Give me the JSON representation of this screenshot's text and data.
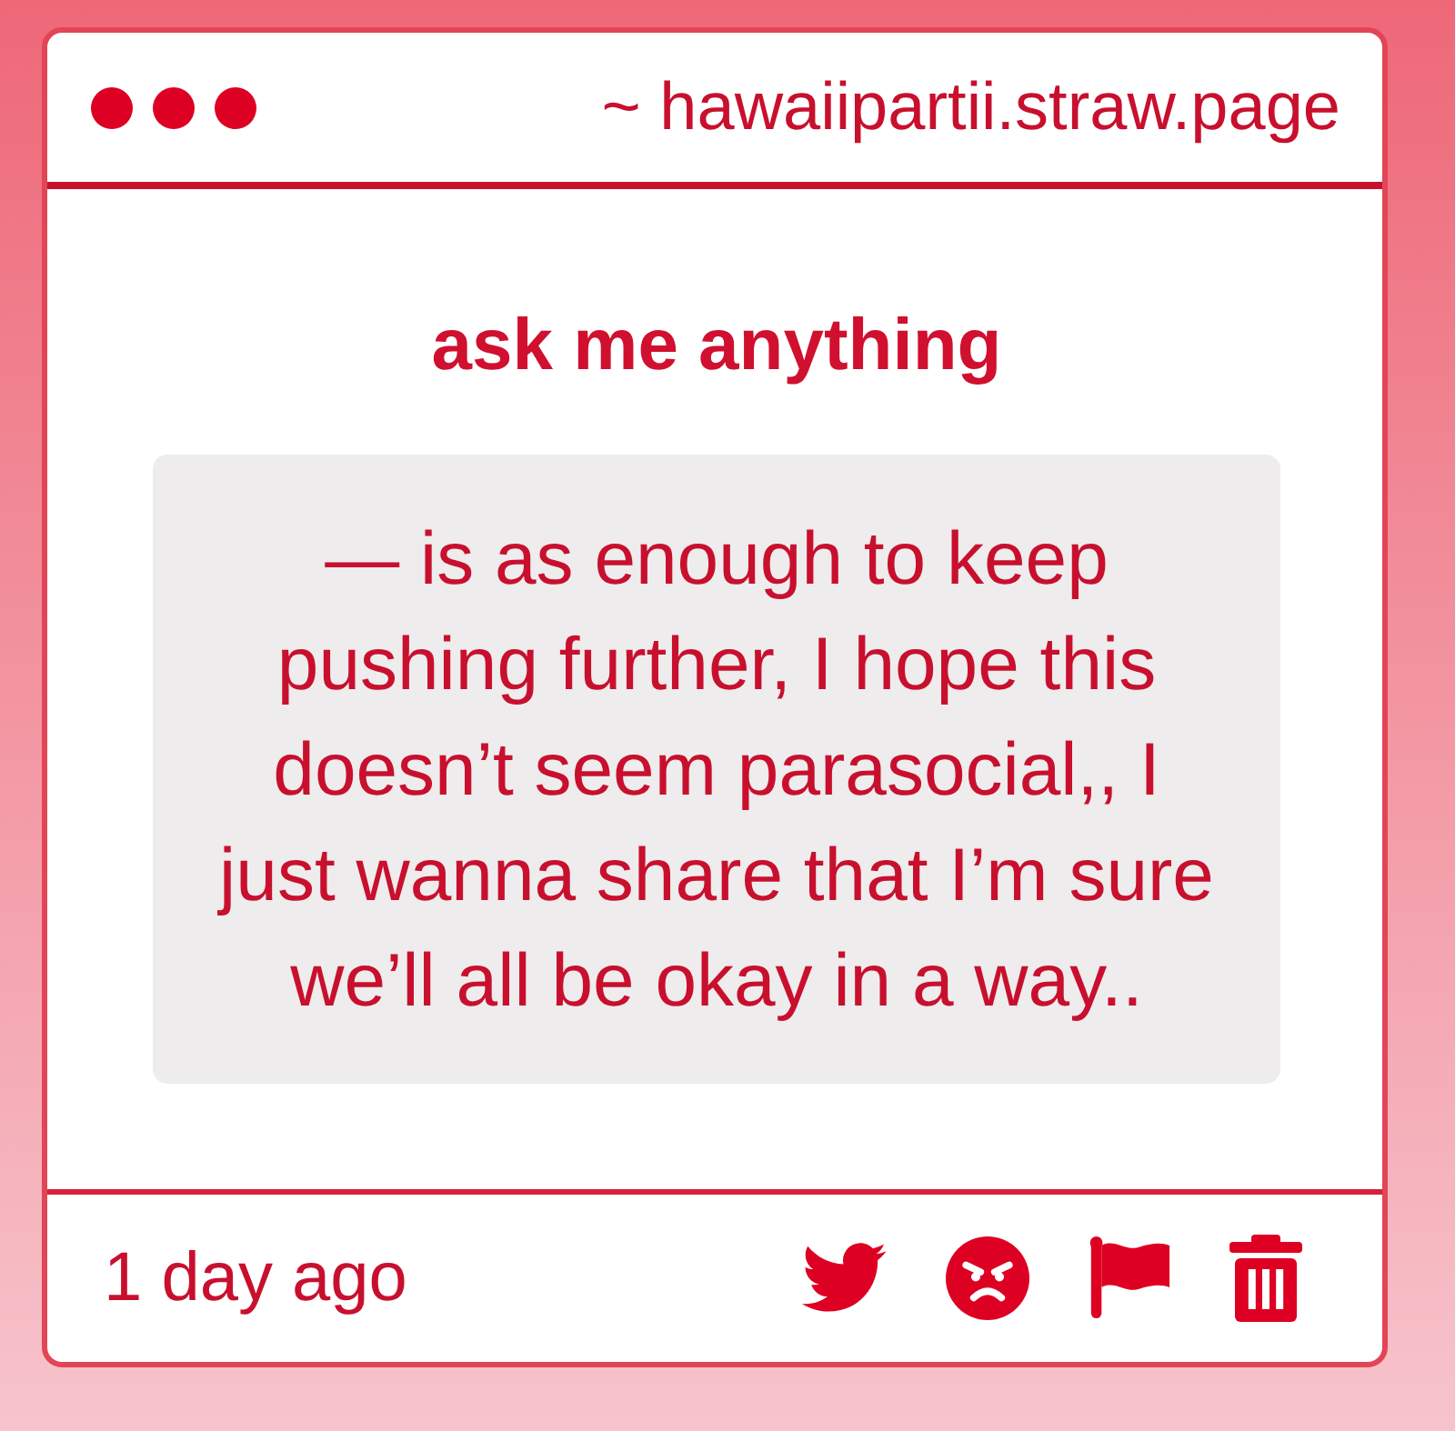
{
  "window": {
    "address": "~ hawaiipartii.straw.page"
  },
  "card": {
    "title": "ask me anything",
    "message": "— is as enough to keep pushing further, I hope this doesn’t seem parasocial,, I just wanna share that I’m sure we’ll all be okay in a way..",
    "time": "1 day ago"
  }
}
